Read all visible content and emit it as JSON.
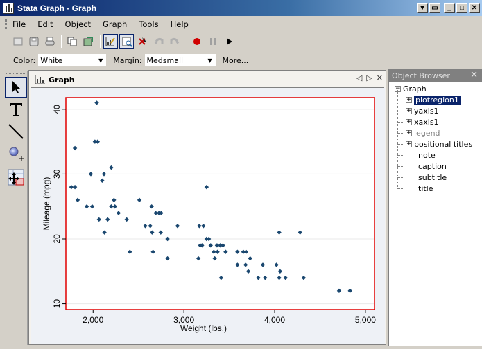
{
  "window": {
    "title": "Stata Graph - Graph",
    "controls": [
      "menu",
      "restore",
      "minimize",
      "maximize",
      "close"
    ]
  },
  "menu": [
    "File",
    "Edit",
    "Object",
    "Graph",
    "Tools",
    "Help"
  ],
  "toolbar": {
    "icons": [
      "open-icon",
      "save-icon",
      "print-icon",
      "copy-icon",
      "rename-icon",
      "graph-editor-icon",
      "recorder-browser-icon",
      "delete-icon",
      "undo-icon",
      "redo-icon",
      "record-icon",
      "pause-icon",
      "play-icon"
    ]
  },
  "properties": {
    "color_label": "Color:",
    "color_value": "White",
    "margin_label": "Margin:",
    "margin_value": "Medsmall",
    "more_label": "More..."
  },
  "tools": [
    "pointer-tool",
    "text-tool",
    "line-tool",
    "marker-tool",
    "grid-edit-tool"
  ],
  "document": {
    "tab_label": "Graph",
    "nav_prev": "◁",
    "nav_next": "▷",
    "close": "✕"
  },
  "object_browser": {
    "title": "Object Browser",
    "close": "✕",
    "root": "Graph",
    "items": [
      {
        "label": "plotregion1",
        "expandable": true,
        "selected": true,
        "disabled": false
      },
      {
        "label": "yaxis1",
        "expandable": true,
        "selected": false,
        "disabled": false
      },
      {
        "label": "xaxis1",
        "expandable": true,
        "selected": false,
        "disabled": false
      },
      {
        "label": "legend",
        "expandable": true,
        "selected": false,
        "disabled": true
      },
      {
        "label": "positional titles",
        "expandable": true,
        "selected": false,
        "disabled": false
      },
      {
        "label": "note",
        "expandable": false,
        "selected": false,
        "disabled": false
      },
      {
        "label": "caption",
        "expandable": false,
        "selected": false,
        "disabled": false
      },
      {
        "label": "subtitle",
        "expandable": false,
        "selected": false,
        "disabled": false
      },
      {
        "label": "title",
        "expandable": false,
        "selected": false,
        "disabled": false
      }
    ]
  },
  "chart_data": {
    "type": "scatter",
    "title": "",
    "xlabel": "Weight (lbs.)",
    "ylabel": "Mileage (mpg)",
    "xlim": [
      1700,
      5100
    ],
    "ylim": [
      9.1,
      41.8
    ],
    "xticks": [
      2000,
      3000,
      4000,
      5000
    ],
    "xtick_labels": [
      "2,000",
      "3,000",
      "4,000",
      "5,000"
    ],
    "yticks": [
      10,
      20,
      30,
      40
    ],
    "ytick_labels": [
      "10",
      "20",
      "30",
      "40"
    ],
    "grid": "horizontal",
    "legend": "none",
    "marker_color": "#1a476f",
    "plotregion_border_color": "#e00000",
    "points": [
      [
        2040,
        41
      ],
      [
        1800,
        34
      ],
      [
        2020,
        35
      ],
      [
        2050,
        35
      ],
      [
        2200,
        31
      ],
      [
        1975,
        30
      ],
      [
        2120,
        30
      ],
      [
        2100,
        29
      ],
      [
        1760,
        28
      ],
      [
        1800,
        28
      ],
      [
        3250,
        28
      ],
      [
        1830,
        26
      ],
      [
        2230,
        26
      ],
      [
        2510,
        26
      ],
      [
        1930,
        25
      ],
      [
        1990,
        25
      ],
      [
        2200,
        25
      ],
      [
        2240,
        25
      ],
      [
        2645,
        25
      ],
      [
        2280,
        24
      ],
      [
        2690,
        24
      ],
      [
        2725,
        24
      ],
      [
        2750,
        24
      ],
      [
        2065,
        23
      ],
      [
        2160,
        23
      ],
      [
        2370,
        23
      ],
      [
        2575,
        22
      ],
      [
        2630,
        22
      ],
      [
        2930,
        22
      ],
      [
        3170,
        22
      ],
      [
        3215,
        22
      ],
      [
        2125,
        21
      ],
      [
        2650,
        21
      ],
      [
        2745,
        21
      ],
      [
        4050,
        21
      ],
      [
        4280,
        21
      ],
      [
        2820,
        20
      ],
      [
        3250,
        20
      ],
      [
        3275,
        20
      ],
      [
        3180,
        19
      ],
      [
        3200,
        19
      ],
      [
        3295,
        19
      ],
      [
        3365,
        19
      ],
      [
        3400,
        19
      ],
      [
        3430,
        19
      ],
      [
        2405,
        18
      ],
      [
        2660,
        18
      ],
      [
        3330,
        18
      ],
      [
        3370,
        18
      ],
      [
        3460,
        18
      ],
      [
        3590,
        18
      ],
      [
        3655,
        18
      ],
      [
        3685,
        18
      ],
      [
        2820,
        17
      ],
      [
        3160,
        17
      ],
      [
        3340,
        17
      ],
      [
        3730,
        17
      ],
      [
        3590,
        16
      ],
      [
        3680,
        16
      ],
      [
        3870,
        16
      ],
      [
        4020,
        16
      ],
      [
        3710,
        15
      ],
      [
        4060,
        15
      ],
      [
        3410,
        14
      ],
      [
        3820,
        14
      ],
      [
        3895,
        14
      ],
      [
        4050,
        14
      ],
      [
        4120,
        14
      ],
      [
        4320,
        14
      ],
      [
        4710,
        12
      ],
      [
        4830,
        12
      ]
    ]
  }
}
